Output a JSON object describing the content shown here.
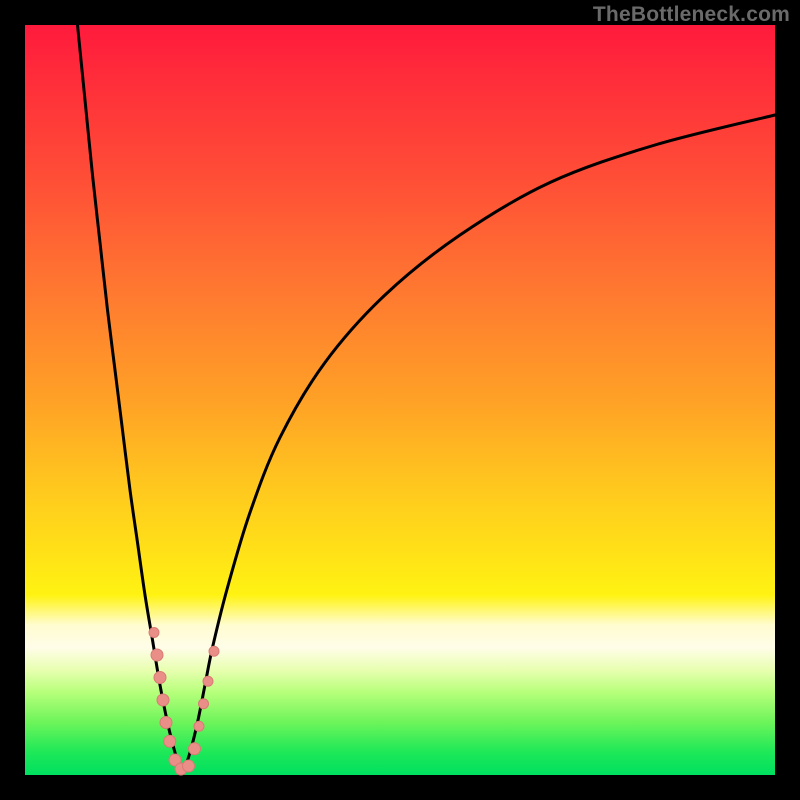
{
  "watermark_text": "TheBottleneck.com",
  "colors": {
    "curve_stroke": "#000000",
    "marker_fill": "#e98f88",
    "marker_stroke": "#d97b74"
  },
  "chart_data": {
    "type": "line",
    "title": "",
    "xlabel": "",
    "ylabel": "",
    "xlim": [
      0,
      100
    ],
    "ylim": [
      0,
      100
    ],
    "series": [
      {
        "name": "left-branch",
        "x": [
          7,
          8,
          9,
          10,
          11,
          12,
          13,
          14,
          15,
          16,
          17,
          18,
          19,
          20,
          21
        ],
        "y": [
          100,
          90,
          80,
          71,
          62,
          54,
          46,
          38,
          31,
          24,
          18,
          12,
          7,
          3,
          0
        ]
      },
      {
        "name": "right-branch",
        "x": [
          21,
          22,
          23,
          24,
          25,
          27,
          30,
          34,
          40,
          48,
          58,
          70,
          84,
          100
        ],
        "y": [
          0,
          3,
          7,
          12,
          17,
          25,
          35,
          45,
          55,
          64,
          72,
          79,
          84,
          88
        ]
      }
    ],
    "markers": [
      {
        "x": 17.2,
        "y": 19,
        "r": 5
      },
      {
        "x": 17.6,
        "y": 16,
        "r": 6
      },
      {
        "x": 18.0,
        "y": 13,
        "r": 6
      },
      {
        "x": 18.4,
        "y": 10,
        "r": 6
      },
      {
        "x": 18.8,
        "y": 7,
        "r": 6
      },
      {
        "x": 19.3,
        "y": 4.5,
        "r": 6
      },
      {
        "x": 20.0,
        "y": 2,
        "r": 6
      },
      {
        "x": 20.8,
        "y": 0.8,
        "r": 6
      },
      {
        "x": 21.8,
        "y": 1.2,
        "r": 6
      },
      {
        "x": 22.6,
        "y": 3.5,
        "r": 6
      },
      {
        "x": 23.2,
        "y": 6.5,
        "r": 5
      },
      {
        "x": 23.8,
        "y": 9.5,
        "r": 5
      },
      {
        "x": 24.4,
        "y": 12.5,
        "r": 5
      },
      {
        "x": 25.2,
        "y": 16.5,
        "r": 5
      }
    ]
  }
}
